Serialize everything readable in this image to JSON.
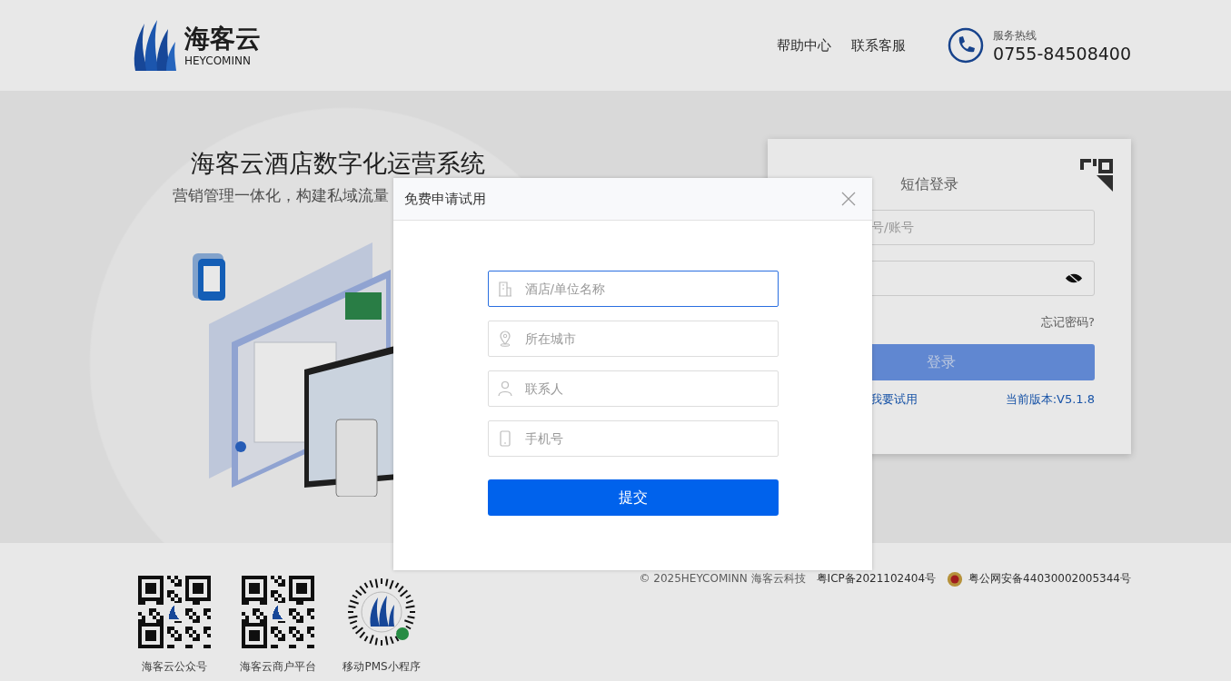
{
  "header": {
    "logo": {
      "name": "海客云",
      "sub": "HEYCOMINN"
    },
    "nav": [
      "帮助中心",
      "联系客服"
    ],
    "hotline": {
      "label": "服务热线",
      "number": "0755-84508400"
    }
  },
  "hero": {
    "title": "海客云酒店数字化运营系统",
    "subtitle": "营销管理一体化，构建私域流量"
  },
  "login": {
    "title": "短信登录",
    "account_placeholder": "号/账号",
    "forgot": "忘记密码?",
    "login_button": "登录",
    "trial_link": "我要试用",
    "version": "当前版本:V5.1.8"
  },
  "dialog": {
    "title": "免费申请试用",
    "fields": [
      {
        "kind": "building",
        "placeholder": "酒店/单位名称",
        "focused": true
      },
      {
        "kind": "pin",
        "placeholder": "所在城市",
        "focused": false
      },
      {
        "kind": "person",
        "placeholder": "联系人",
        "focused": false
      },
      {
        "kind": "phone",
        "placeholder": "手机号",
        "focused": false
      }
    ],
    "submit": "提交"
  },
  "footer": {
    "qr_codes": [
      {
        "kind": "qr",
        "caption": "海客云公众号"
      },
      {
        "kind": "qr",
        "caption": "海客云商户平台"
      },
      {
        "kind": "mini",
        "caption": "移动PMS小程序"
      }
    ],
    "copyright": "© 2025HEYCOMINN 海客云科技",
    "icp": "粤ICP备2021102404号",
    "police": "粤公网安备44030002005344号"
  }
}
